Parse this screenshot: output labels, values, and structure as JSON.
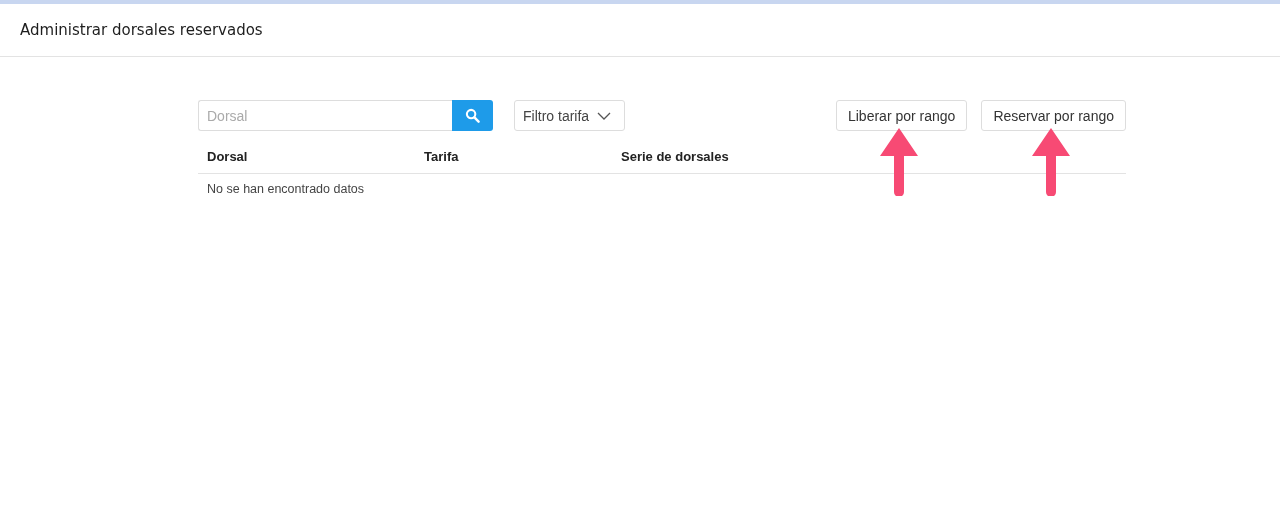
{
  "header": {
    "title": "Administrar dorsales reservados"
  },
  "search": {
    "placeholder": "Dorsal"
  },
  "filter": {
    "label": "Filtro tarifa"
  },
  "actions": [
    {
      "label": "Liberar por rango",
      "marked": true
    },
    {
      "label": "Reservar por rango",
      "marked": true
    }
  ],
  "table": {
    "columns": [
      "Dorsal",
      "Tarifa",
      "Serie de dorsales"
    ],
    "empty_message": "No se han encontrado datos"
  }
}
